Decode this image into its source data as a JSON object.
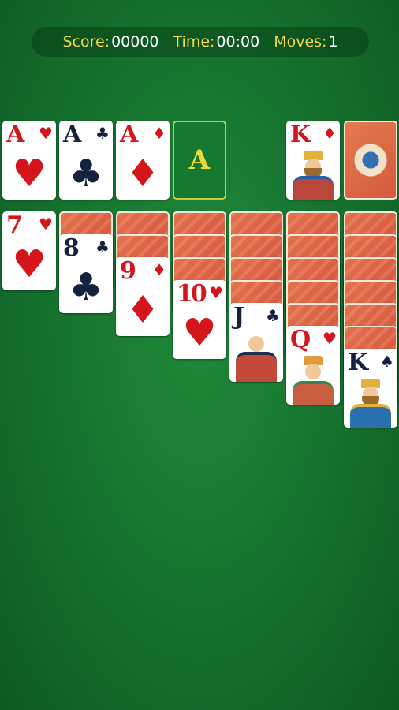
{
  "status": {
    "score_label": "Score:",
    "score_value": "00000",
    "time_label": "Time:",
    "time_value": "00:00",
    "moves_label": "Moves:",
    "moves_value": "1"
  },
  "foundations": [
    {
      "rank": "A",
      "suit": "♥",
      "color": "red"
    },
    {
      "rank": "A",
      "suit": "♣",
      "color": "black"
    },
    {
      "rank": "A",
      "suit": "♦",
      "color": "red"
    },
    {
      "empty_label": "A"
    }
  ],
  "waste": {
    "rank": "K",
    "suit": "♦",
    "color": "red"
  },
  "tableau": [
    {
      "facedown": 0,
      "top": {
        "rank": "7",
        "suit": "♥",
        "color": "red"
      }
    },
    {
      "facedown": 1,
      "top": {
        "rank": "8",
        "suit": "♣",
        "color": "black"
      }
    },
    {
      "facedown": 2,
      "top": {
        "rank": "9",
        "suit": "♦",
        "color": "red"
      }
    },
    {
      "facedown": 3,
      "top": {
        "rank": "10",
        "suit": "♥",
        "color": "red"
      }
    },
    {
      "facedown": 4,
      "top": {
        "rank": "J",
        "suit": "♣",
        "color": "black"
      }
    },
    {
      "facedown": 5,
      "top": {
        "rank": "Q",
        "suit": "♥",
        "color": "red"
      }
    },
    {
      "facedown": 6,
      "top": {
        "rank": "K",
        "suit": "♠",
        "color": "black"
      }
    }
  ],
  "colors": {
    "felt": "#15702d",
    "accent": "#f3d64a",
    "red": "#d4161c",
    "black": "#15223f"
  }
}
